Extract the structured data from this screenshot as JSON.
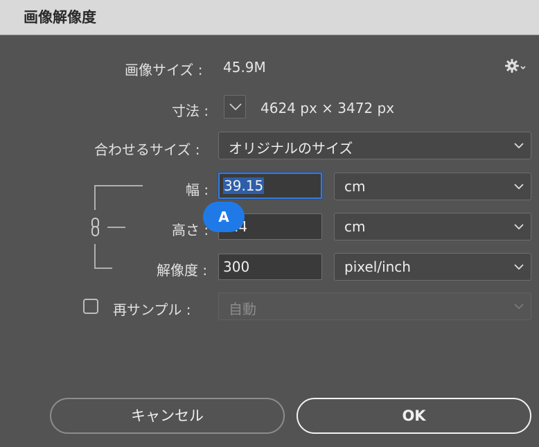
{
  "window": {
    "title": "画像解像度"
  },
  "image_size": {
    "label": "画像サイズ :",
    "value": "45.9M"
  },
  "settings": {
    "icon": "gear-icon"
  },
  "dimensions": {
    "label": "寸法 :",
    "value": "4624 px × 3472 px"
  },
  "fit_to": {
    "label": "合わせるサイズ :",
    "selected": "オリジナルのサイズ"
  },
  "width": {
    "label": "幅 :",
    "value": "39.15",
    "unit": "cm"
  },
  "height": {
    "label": "高さ :",
    "value": "29.4",
    "visible_value": ".4",
    "unit": "cm"
  },
  "resolution": {
    "label": "解像度 :",
    "value": "300",
    "unit": "pixel/inch"
  },
  "resample": {
    "label": "再サンプル :",
    "checked": false,
    "selected": "自動"
  },
  "overlay_badge": {
    "label": "A"
  },
  "buttons": {
    "cancel": "キャンセル",
    "ok": "OK"
  },
  "colors": {
    "accent": "#1f7ae8",
    "focus": "#3a7bd5",
    "background": "#535353"
  }
}
